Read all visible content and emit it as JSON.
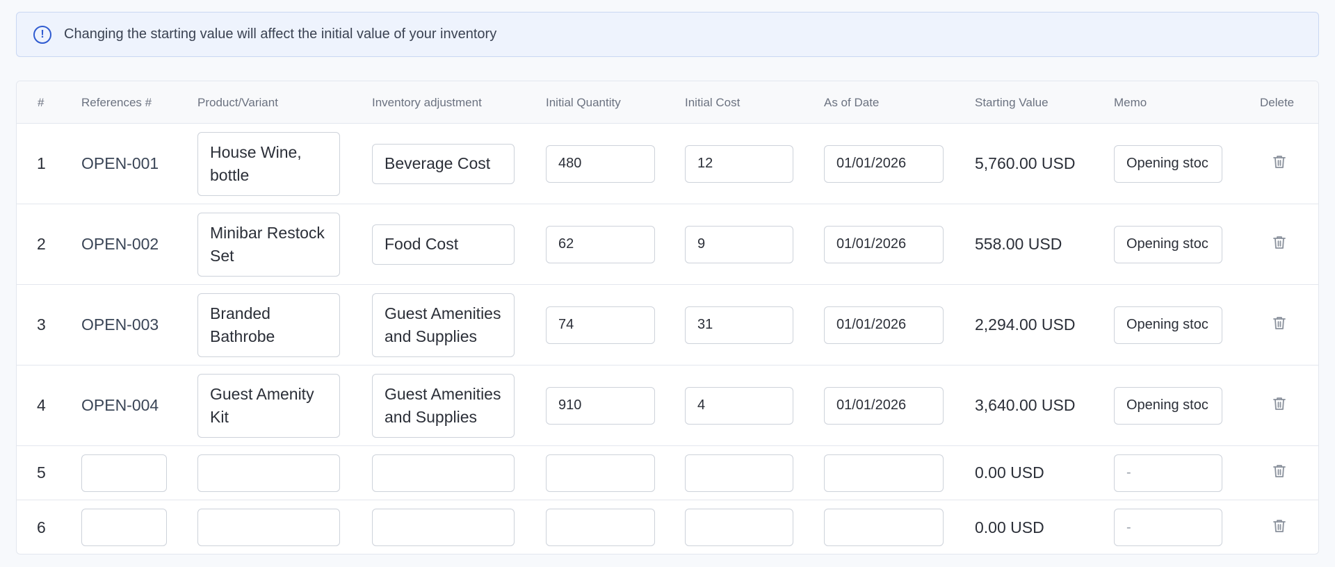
{
  "banner": {
    "icon": "info-circle-icon",
    "message": "Changing the starting value will affect the initial value of your inventory"
  },
  "table": {
    "headers": {
      "num": "#",
      "reference": "References #",
      "product": "Product/Variant",
      "adjustment": "Inventory adjustment",
      "quantity": "Initial Quantity",
      "cost": "Initial Cost",
      "date": "As of Date",
      "value": "Starting Value",
      "memo": "Memo",
      "delete": "Delete"
    },
    "rows": [
      {
        "num": "1",
        "reference": "OPEN-001",
        "product": "House Wine, bottle",
        "adjustment": "Beverage Cost",
        "quantity": "480",
        "cost": "12",
        "date": "01/01/2026",
        "value": "5,760.00 USD",
        "memo": "Opening stoc"
      },
      {
        "num": "2",
        "reference": "OPEN-002",
        "product": "Minibar Restock Set",
        "adjustment": "Food Cost",
        "quantity": "62",
        "cost": "9",
        "date": "01/01/2026",
        "value": "558.00 USD",
        "memo": "Opening stoc"
      },
      {
        "num": "3",
        "reference": "OPEN-003",
        "product": "Branded Bathrobe",
        "adjustment": "Guest Amenities and Supplies",
        "quantity": "74",
        "cost": "31",
        "date": "01/01/2026",
        "value": "2,294.00 USD",
        "memo": "Opening stoc"
      },
      {
        "num": "4",
        "reference": "OPEN-004",
        "product": "Guest Amenity Kit",
        "adjustment": "Guest Amenities and Supplies",
        "quantity": "910",
        "cost": "4",
        "date": "01/01/2026",
        "value": "3,640.00 USD",
        "memo": "Opening stoc"
      },
      {
        "num": "5",
        "reference": "",
        "product": "",
        "adjustment": "",
        "quantity": "",
        "cost": "",
        "date": "",
        "value": "0.00 USD",
        "memo": "-"
      },
      {
        "num": "6",
        "reference": "",
        "product": "",
        "adjustment": "",
        "quantity": "",
        "cost": "",
        "date": "",
        "value": "0.00 USD",
        "memo": "-"
      }
    ],
    "delete_icon": "trash-icon"
  },
  "colors": {
    "banner_bg": "#eef3fd",
    "banner_border": "#c9d7f2",
    "info_icon": "#2f5bd0",
    "border": "#cdd2da",
    "header_text": "#6b7280"
  }
}
